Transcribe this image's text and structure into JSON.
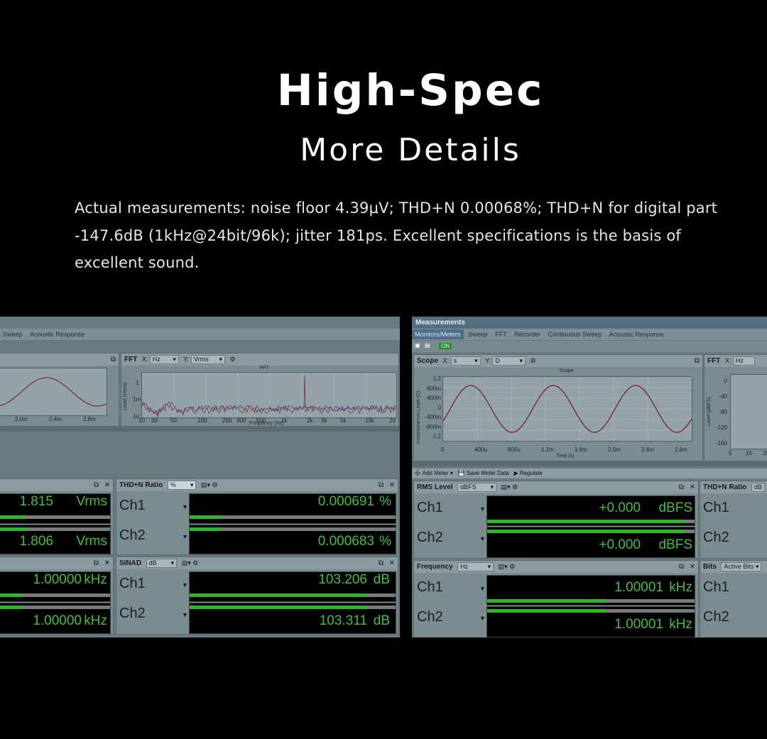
{
  "heading": {
    "title": "High-Spec",
    "subtitle": "More Details"
  },
  "description": "Actual measurements: noise floor 4.39μV; THD+N 0.00068%; THD+N for digital part -147.6dB (1kHz@24bit/96k); jitter 181ps. Excellent specifications is the basis of excellent sound.",
  "left_window": {
    "tabs": [
      "Sweep",
      "Acoustic Response"
    ],
    "fft": {
      "title": "FFT",
      "x_label": "X:",
      "x_unit": "Hz",
      "y_label": "Y:",
      "y_unit": "Vrms",
      "plot_title": "FFT",
      "y_axis_label": "Level (Vrms)",
      "x_axis_label": "Frequency (Hz)",
      "y_ticks": [
        "1",
        "1m",
        "1u"
      ],
      "x_ticks": [
        "20",
        "30",
        "50",
        "100",
        "200",
        "300",
        "500",
        "1k",
        "2k",
        "3k",
        "5k",
        "10k",
        "20"
      ]
    },
    "scope_x_ticks": [
      "2.0m",
      "2.4m",
      "2.8m"
    ],
    "level": {
      "ch1_value": "1.815",
      "ch1_unit": "Vrms",
      "ch2_value": "1.806",
      "ch2_unit": "Vrms",
      "ch1_fill": 0.24,
      "ch2_fill": 0.24
    },
    "thdn": {
      "title": "THD+N Ratio",
      "unit": "%",
      "ch1_label": "Ch1",
      "ch2_label": "Ch2",
      "ch1_value": "0.000691",
      "ch1_unit": "%",
      "ch2_value": "0.000683",
      "ch2_unit": "%",
      "ch1_fill": 0.15,
      "ch2_fill": 0.15
    },
    "freq": {
      "ch1_value": "1.00000",
      "ch1_unit": "kHz",
      "ch2_value": "1.00000",
      "ch2_unit": "kHz",
      "ch1_fill": 0.2,
      "ch2_fill": 0.2
    },
    "sinad": {
      "title": "SINAD",
      "unit": "dB",
      "ch1_label": "Ch1",
      "ch2_label": "Ch2",
      "ch1_value": "103.206",
      "ch1_unit": "dB",
      "ch2_value": "103.311",
      "ch2_unit": "dB",
      "ch1_fill": 0.86,
      "ch2_fill": 0.86
    }
  },
  "right_window": {
    "title": "Measurements",
    "tabs": [
      "Monitors/Meters",
      "Sweep",
      "FFT",
      "Recorder",
      "Continuous Sweep",
      "Acoustic Response"
    ],
    "on_label": "ON",
    "scope": {
      "title": "Scope",
      "x_label": "X:",
      "x_unit": "s",
      "y_label": "Y:",
      "y_unit": "D",
      "plot_title": "Scope",
      "y_axis_label": "Instantaneous Level (D)",
      "x_axis_label": "Time (s)",
      "y_ticks": [
        "1.2",
        "800m",
        "400m",
        "0",
        "-400m",
        "-800m",
        "-1.2"
      ],
      "x_ticks": [
        "0",
        "400u",
        "800u",
        "1.2m",
        "1.6m",
        "2.0m",
        "2.4m",
        "2.8m"
      ]
    },
    "fft": {
      "title": "FFT",
      "x_label": "X:",
      "x_unit": "Hz",
      "y_axis_label": "Level (dBFS)",
      "y_ticks": [
        "0",
        "-40",
        "-80",
        "-120",
        "-160"
      ],
      "x_ticks": [
        "5",
        "10",
        "20"
      ]
    },
    "toolbar": {
      "add_meter": "Add Meter",
      "save_meter": "Save Meter Data",
      "regulate": "Regulate"
    },
    "rms": {
      "title": "RMS Level",
      "unit": "dBFS",
      "ch1_label": "Ch1",
      "ch2_label": "Ch2",
      "ch1_value": "+0.000",
      "ch1_unit": "dBFS",
      "ch2_value": "+0.000",
      "ch2_unit": "dBFS",
      "ch1_fill": 0.95,
      "ch2_fill": 0.95
    },
    "thdn_title": "THD+N Ratio",
    "thdn_unit": "dB",
    "freq": {
      "title": "Frequency",
      "unit": "Hz",
      "ch1_label": "Ch1",
      "ch2_label": "Ch2",
      "ch1_value": "1.00001",
      "ch1_unit": "kHz",
      "ch2_value": "1.00001",
      "ch2_unit": "kHz",
      "ch1_fill": 0.57,
      "ch2_fill": 0.57
    },
    "bits": {
      "title": "Bits",
      "unit": "Active Bits",
      "ch1_label": "Ch1",
      "ch2_label": "Ch2"
    }
  }
}
